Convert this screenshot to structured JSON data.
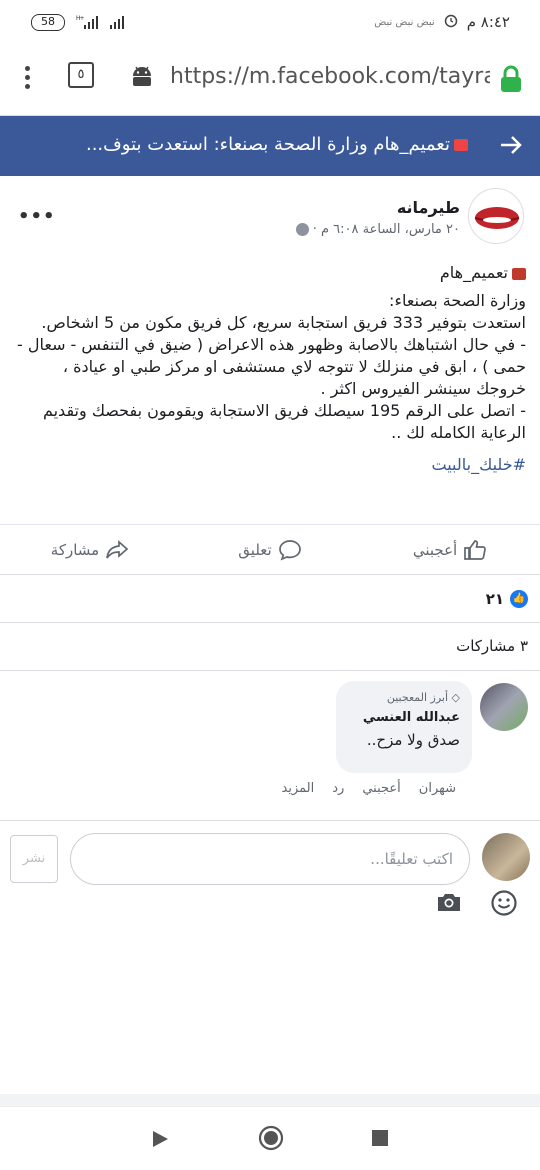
{
  "status": {
    "battery": "58",
    "time": "٨:٤٢ م",
    "net_label": "H+",
    "notif_text": "نبض  نبض  نبض"
  },
  "browser": {
    "tab_count": "٥",
    "url": "https://m.facebook.com/tayrama"
  },
  "banner": {
    "text": "تعميم_هام وزارة الصحة بصنعاء: استعدت بتوف..."
  },
  "post": {
    "author": "طيرمانه",
    "timestamp": "٢٠ مارس، الساعة ٦:٠٨ م ·",
    "lines": [
      "تعميم_هام",
      "وزارة الصحة بصنعاء:",
      "استعدت بتوفير 333 فريق استجابة سريع، كل فريق مكون من 5 اشخاص.",
      "- في حال اشتباهك بالاصابة وظهور هذه الاعراض ( ضيق في التنفس - سعال - حمى ) ، ابق في منزلك لا تتوجه لاي مستشفى او مركز طبي او عيادة ، خروجك سينشر الفيروس اكثر .",
      "- اتصل على الرقم 195 سيصلك فريق الاستجابة ويقومون بفحصك وتقديم الرعاية الكامله لك .."
    ],
    "hashtag": "#خليك_بالبيت"
  },
  "actions": {
    "like": "أعجبني",
    "comment": "تعليق",
    "share": "مشاركة"
  },
  "reactions": {
    "count": "٢١"
  },
  "shares": {
    "text": "٣ مشاركات"
  },
  "comment": {
    "badge": "أبرز المعجبين",
    "name": "عبدالله العنسي",
    "text": "صدق ولا مزح..",
    "time": "شهران",
    "like": "أعجبني",
    "reply": "رد",
    "more": "المزيد"
  },
  "composer": {
    "placeholder": "اكتب تعليقًا...",
    "post_label": "نشر"
  },
  "colors": {
    "brand": "#3b5998",
    "link": "#385898",
    "like_blue": "#1877f2"
  }
}
